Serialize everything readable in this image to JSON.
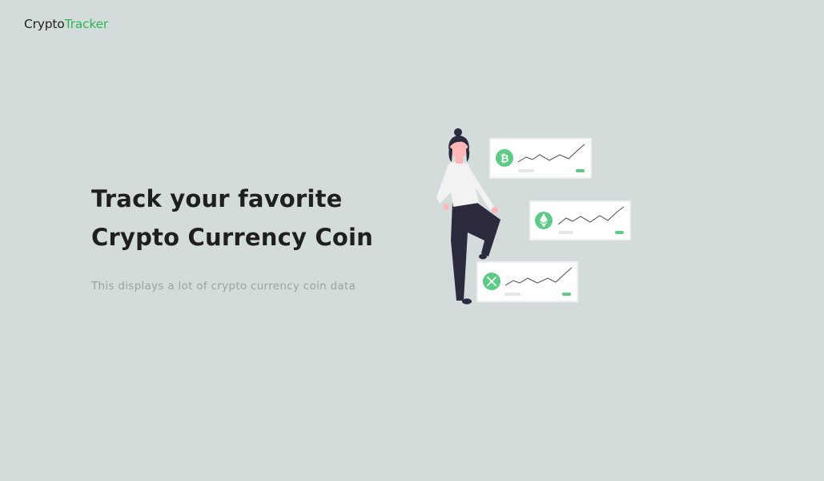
{
  "brand": {
    "name_part1": "Crypto",
    "name_part2": "Tracker",
    "accent_color": "#2fb35a"
  },
  "hero": {
    "title_line1": "Track your favorite",
    "title_line2": "Crypto Currency Coin",
    "subtitle": "This displays a lot of crypto currency coin data"
  },
  "illustration": {
    "coins": [
      "bitcoin-icon",
      "ethereum-icon",
      "ripple-icon"
    ],
    "card_accent": "#5dcb86",
    "background": "#d3dcda"
  }
}
